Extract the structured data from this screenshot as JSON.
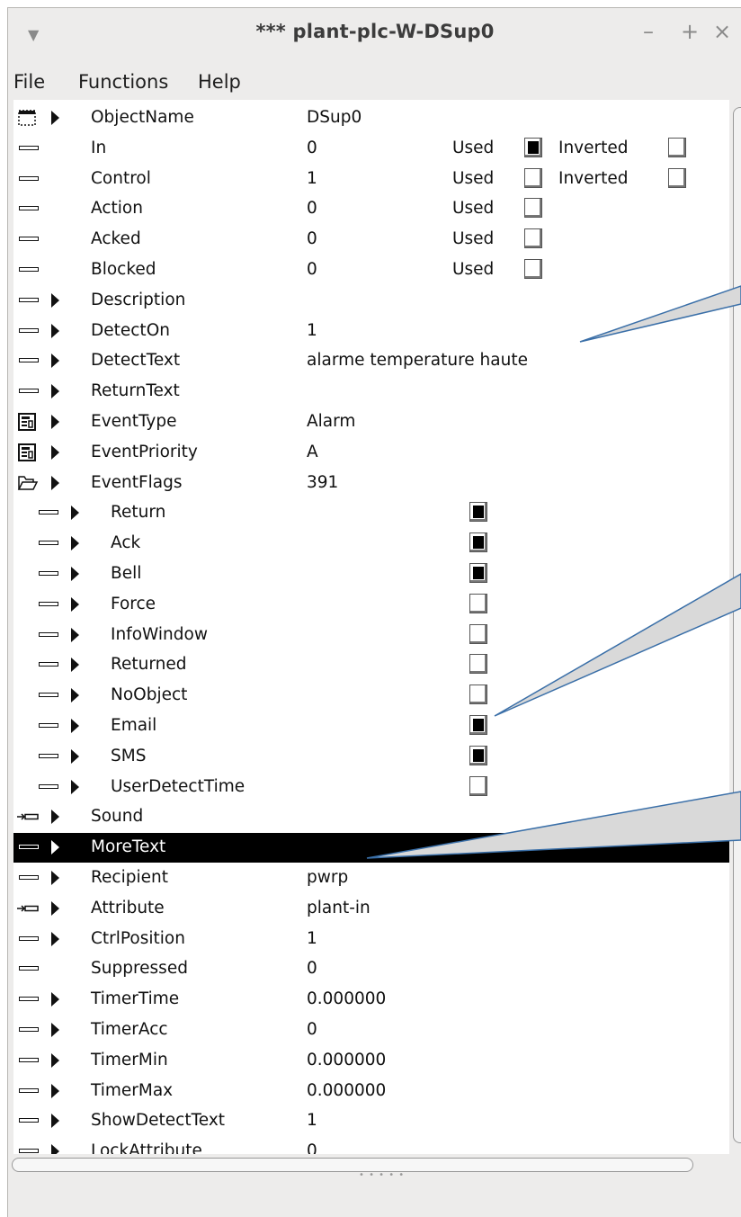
{
  "window": {
    "title": "*** plant-plc-W-DSup0",
    "buttons": {
      "minimize": "–",
      "maximize": "+",
      "close": "×"
    }
  },
  "menu": [
    "File",
    "Functions",
    "Help"
  ],
  "rows": [
    {
      "icon": "object",
      "arrow": true,
      "indent": 0,
      "name": "ObjectName",
      "value": "DSup0"
    },
    {
      "icon": "attr",
      "arrow": false,
      "indent": 0,
      "name": "In",
      "value": "0",
      "used_label": "Used",
      "used": true,
      "inverted_label": "Inverted",
      "inverted": false
    },
    {
      "icon": "attr",
      "arrow": false,
      "indent": 0,
      "name": "Control",
      "value": "1",
      "used_label": "Used",
      "used": false,
      "inverted_label": "Inverted",
      "inverted": false
    },
    {
      "icon": "attr",
      "arrow": false,
      "indent": 0,
      "name": "Action",
      "value": "0",
      "used_label": "Used",
      "used": false
    },
    {
      "icon": "attr",
      "arrow": false,
      "indent": 0,
      "name": "Acked",
      "value": "0",
      "used_label": "Used",
      "used": false
    },
    {
      "icon": "attr",
      "arrow": false,
      "indent": 0,
      "name": "Blocked",
      "value": "0",
      "used_label": "Used",
      "used": false
    },
    {
      "icon": "attr",
      "arrow": true,
      "indent": 0,
      "name": "Description",
      "value": ""
    },
    {
      "icon": "attr",
      "arrow": true,
      "indent": 0,
      "name": "DetectOn",
      "value": "1"
    },
    {
      "icon": "attr",
      "arrow": true,
      "indent": 0,
      "name": "DetectText",
      "value": "alarme temperature haute"
    },
    {
      "icon": "attr",
      "arrow": true,
      "indent": 0,
      "name": "ReturnText",
      "value": ""
    },
    {
      "icon": "enum",
      "arrow": true,
      "indent": 0,
      "name": "EventType",
      "value": "Alarm"
    },
    {
      "icon": "enum",
      "arrow": true,
      "indent": 0,
      "name": "EventPriority",
      "value": "A"
    },
    {
      "icon": "folder",
      "arrow": true,
      "indent": 0,
      "name": "EventFlags",
      "value": "391"
    },
    {
      "icon": "attr",
      "arrow": true,
      "indent": 1,
      "name": "Return",
      "flag": true
    },
    {
      "icon": "attr",
      "arrow": true,
      "indent": 1,
      "name": "Ack",
      "flag": true
    },
    {
      "icon": "attr",
      "arrow": true,
      "indent": 1,
      "name": "Bell",
      "flag": true
    },
    {
      "icon": "attr",
      "arrow": true,
      "indent": 1,
      "name": "Force",
      "flag": false
    },
    {
      "icon": "attr",
      "arrow": true,
      "indent": 1,
      "name": "InfoWindow",
      "flag": false
    },
    {
      "icon": "attr",
      "arrow": true,
      "indent": 1,
      "name": "Returned",
      "flag": false
    },
    {
      "icon": "attr",
      "arrow": true,
      "indent": 1,
      "name": "NoObject",
      "flag": false
    },
    {
      "icon": "attr",
      "arrow": true,
      "indent": 1,
      "name": "Email",
      "flag": true
    },
    {
      "icon": "attr",
      "arrow": true,
      "indent": 1,
      "name": "SMS",
      "flag": true
    },
    {
      "icon": "attr",
      "arrow": true,
      "indent": 1,
      "name": "UserDetectTime",
      "flag": false
    },
    {
      "icon": "ref",
      "arrow": true,
      "indent": 0,
      "name": "Sound",
      "value": ""
    },
    {
      "icon": "attr",
      "arrow": true,
      "indent": 0,
      "name": "MoreText",
      "value": "",
      "selected": true
    },
    {
      "icon": "attr",
      "arrow": true,
      "indent": 0,
      "name": "Recipient",
      "value": "pwrp"
    },
    {
      "icon": "ref",
      "arrow": true,
      "indent": 0,
      "name": "Attribute",
      "value": "plant-in"
    },
    {
      "icon": "attr",
      "arrow": true,
      "indent": 0,
      "name": "CtrlPosition",
      "value": "1"
    },
    {
      "icon": "attr",
      "arrow": false,
      "indent": 0,
      "name": "Suppressed",
      "value": "0"
    },
    {
      "icon": "attr",
      "arrow": true,
      "indent": 0,
      "name": "TimerTime",
      "value": "0.000000"
    },
    {
      "icon": "attr",
      "arrow": true,
      "indent": 0,
      "name": "TimerAcc",
      "value": "0"
    },
    {
      "icon": "attr",
      "arrow": true,
      "indent": 0,
      "name": "TimerMin",
      "value": "0.000000"
    },
    {
      "icon": "attr",
      "arrow": true,
      "indent": 0,
      "name": "TimerMax",
      "value": "0.000000"
    },
    {
      "icon": "attr",
      "arrow": true,
      "indent": 0,
      "name": "ShowDetectText",
      "value": "1"
    },
    {
      "icon": "attr",
      "arrow": true,
      "indent": 0,
      "name": "LockAttribute",
      "value": "0"
    }
  ],
  "callout_color": "#d9d9d9",
  "callout_line": "#3a6fa8"
}
